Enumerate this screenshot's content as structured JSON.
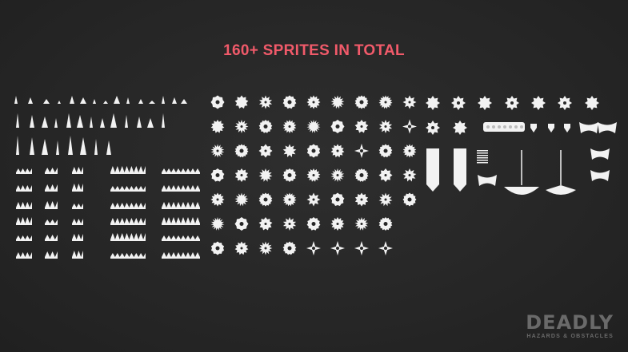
{
  "title": "160+ SPRITES IN TOTAL",
  "logo": {
    "word": "DEADLY",
    "subtitle": "HAZARDS & OBSTACLES"
  },
  "colors": {
    "accent": "#f15a6a",
    "sprite": "#f2f2f2",
    "logo": "#6a6a6a"
  },
  "groups": {
    "spikes": "spike-sprite",
    "saws": "saw-blade-sprite",
    "maces": "mace-axe-sprite"
  }
}
